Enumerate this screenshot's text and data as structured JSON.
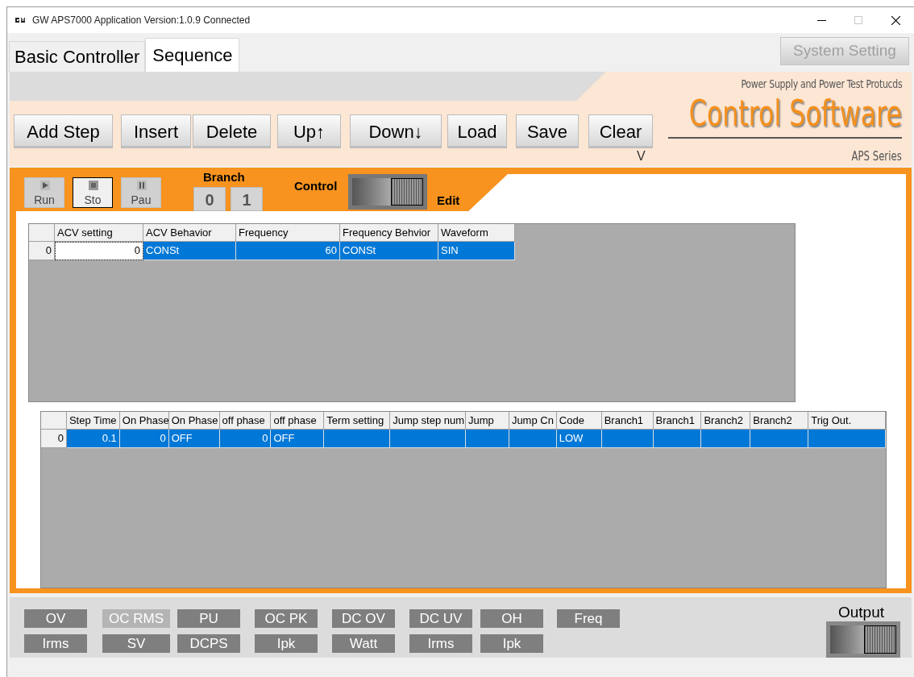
{
  "window": {
    "title": "GW APS7000 Application Version:1.0.9 Connected"
  },
  "tabs": [
    {
      "label": "Basic Controller",
      "selected": false
    },
    {
      "label": "Sequence",
      "selected": true
    }
  ],
  "system_button": {
    "label": "System Setting",
    "disabled": true
  },
  "header": {
    "tagline": "Power Supply and Power Test Protucds",
    "product": "Control Software",
    "series": "APS Series",
    "marker": "V"
  },
  "toolbar": [
    "Add Step",
    "Insert",
    "Delete",
    "Up↑",
    "Down↓",
    "Load",
    "Save",
    "Clear"
  ],
  "run_controls": [
    {
      "kind": "run",
      "label": "Run",
      "selected": false
    },
    {
      "kind": "stop",
      "label": "Sto",
      "selected": true
    },
    {
      "kind": "pause",
      "label": "Pau",
      "selected": false
    }
  ],
  "branch": {
    "label": "Branch",
    "buttons": [
      "0",
      "1"
    ]
  },
  "mode_switch": {
    "left_label": "Control",
    "right_label": "Edit",
    "on": true
  },
  "grid_1": {
    "columns": [
      "ACV setting",
      "ACV Behavior",
      "Frequency",
      "Frequency Behvior",
      "Waveform"
    ],
    "rows": [
      {
        "header": "0",
        "selected": true,
        "cells": [
          "0",
          "CONSt",
          "60",
          "CONSt",
          "SIN"
        ]
      }
    ]
  },
  "grid_2": {
    "columns": [
      "Step Time",
      "On Phase",
      "On Phase",
      "off phase",
      "off phase",
      "Term setting",
      "Jump step num",
      "Jump",
      "Jump Cn",
      "Code",
      "Branch1",
      "Branch1",
      "Branch2",
      "Branch2",
      "Trig Out."
    ],
    "rows": [
      {
        "header": "0",
        "selected": true,
        "cells": [
          "0.1",
          "0",
          "OFF",
          "0",
          "OFF",
          "",
          "",
          "",
          "",
          "LOW",
          "",
          "",
          "",
          "",
          ""
        ]
      }
    ]
  },
  "indicators": [
    [
      {
        "label": "OV",
        "lit": false
      },
      {
        "label": "OC RMS",
        "lit": true
      },
      {
        "label": "PU",
        "lit": false
      },
      {
        "label": "OC PK",
        "lit": false
      },
      {
        "label": "DC OV",
        "lit": false
      },
      {
        "label": "DC UV",
        "lit": false
      },
      {
        "label": "OH",
        "lit": false
      },
      {
        "label": "Freq",
        "lit": false
      }
    ],
    [
      {
        "label": "Irms",
        "lit": false
      },
      {
        "label": "SV",
        "lit": false
      },
      {
        "label": "DCPS",
        "lit": false
      },
      {
        "label": "Ipk",
        "lit": false
      },
      {
        "label": "Watt",
        "lit": false
      },
      {
        "label": "Irms",
        "lit": false
      },
      {
        "label": "Ipk",
        "lit": false
      }
    ]
  ],
  "output": {
    "label": "Output",
    "on": true
  }
}
